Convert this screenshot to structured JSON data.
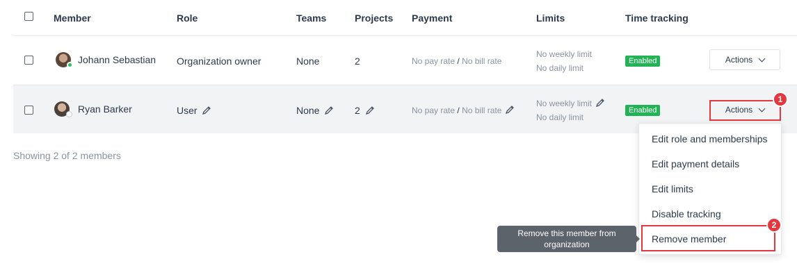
{
  "table": {
    "headers": [
      "Member",
      "Role",
      "Teams",
      "Projects",
      "Payment",
      "Limits",
      "Time tracking"
    ],
    "rows": [
      {
        "name": "Johann Sebastian",
        "role": "Organization owner",
        "teams": "None",
        "projects": "2",
        "pay_rate": "No pay rate",
        "separator": "/",
        "bill_rate": "No bill rate",
        "weekly_limit": "No weekly limit",
        "daily_limit": "No daily limit",
        "tracking": "Enabled",
        "actions": "Actions",
        "presence": "online"
      },
      {
        "name": "Ryan Barker",
        "role": "User",
        "teams": "None",
        "projects": "2",
        "pay_rate": "No pay rate",
        "separator": "/",
        "bill_rate": "No bill rate",
        "weekly_limit": "No weekly limit",
        "daily_limit": "No daily limit",
        "tracking": "Enabled",
        "actions": "Actions",
        "presence": "offline"
      }
    ]
  },
  "footer": {
    "count_text": "Showing 2 of 2 members"
  },
  "dropdown": {
    "items": [
      "Edit role and memberships",
      "Edit payment details",
      "Edit limits",
      "Disable tracking",
      "Remove member"
    ]
  },
  "tooltip": {
    "text": "Remove this member from organization"
  },
  "steps": [
    "1",
    "2"
  ],
  "colors": {
    "accent_red": "#e5373f",
    "enabled_green": "#22b357",
    "online_green": "#22c55e"
  },
  "icons": {
    "edit": "pencil-icon",
    "dropdown": "chevron-down-icon"
  }
}
